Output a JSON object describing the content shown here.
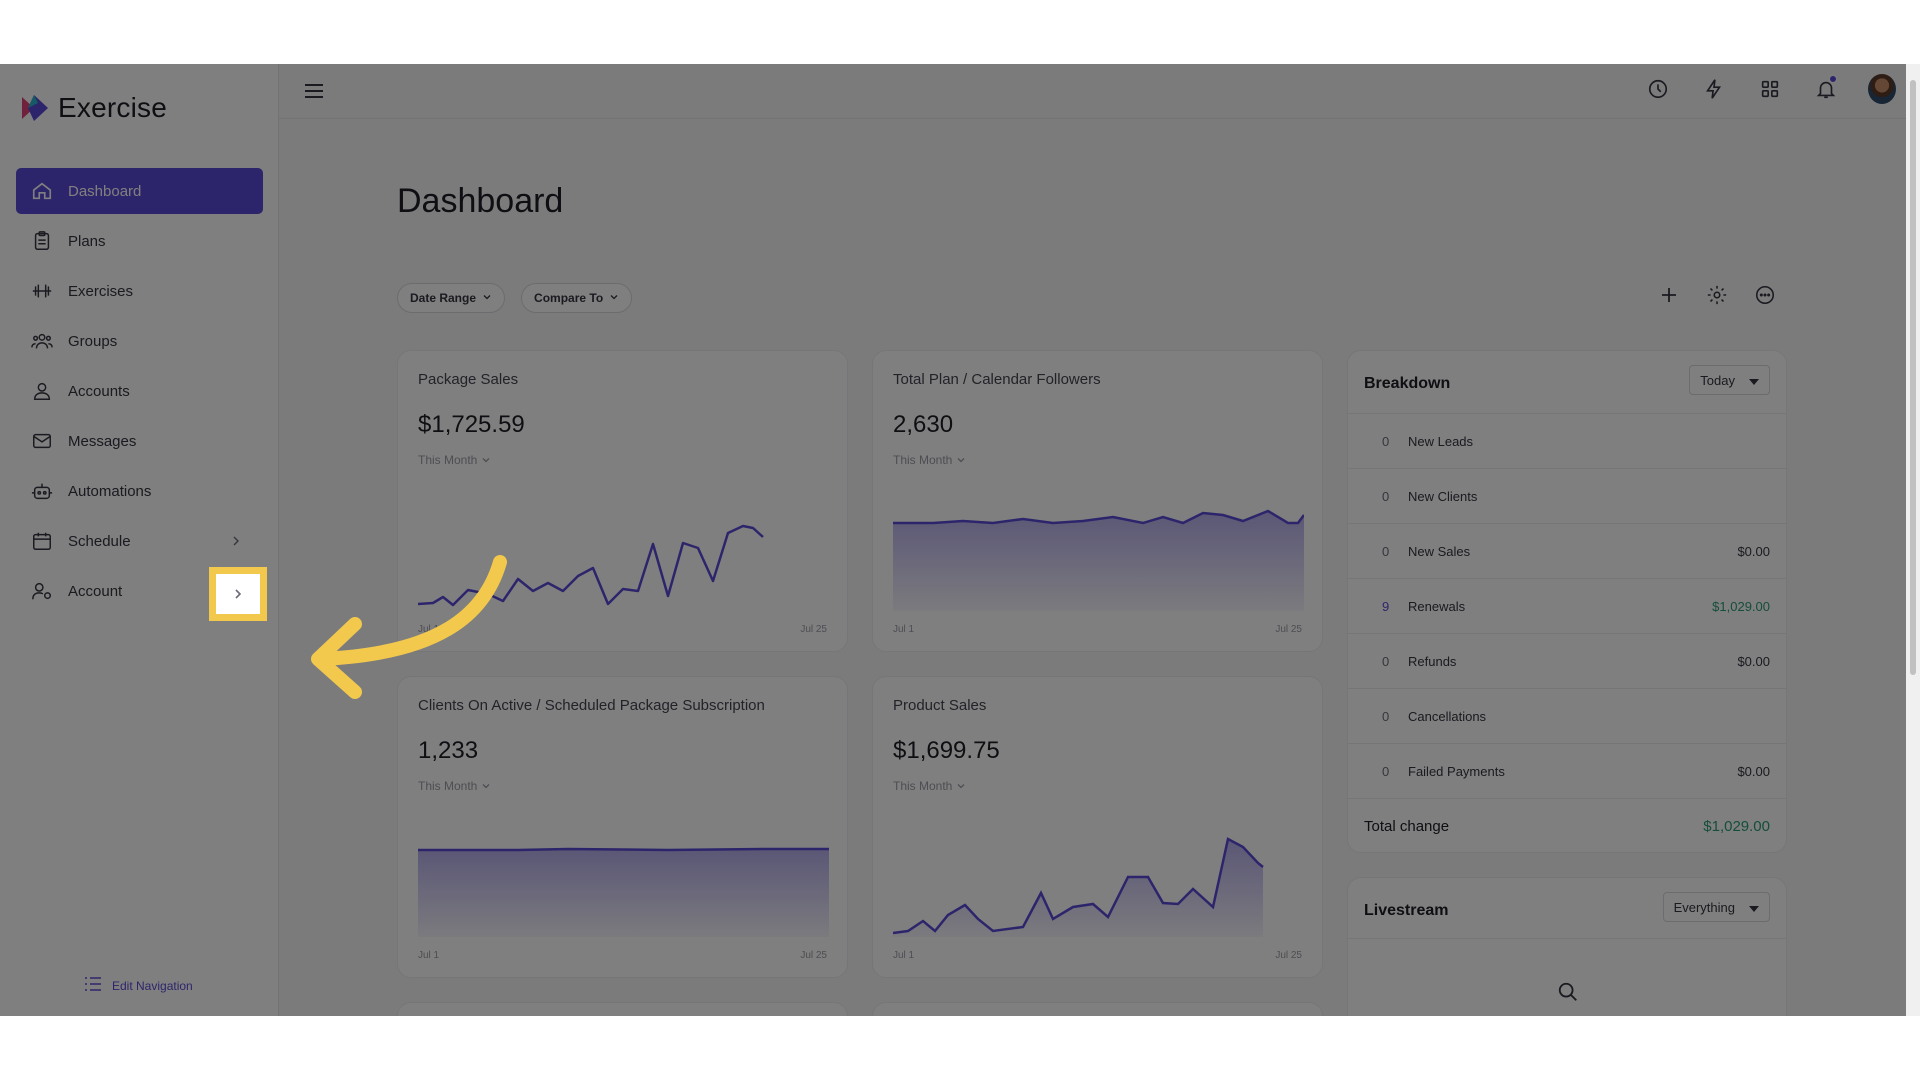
{
  "app": {
    "name": "Exercise"
  },
  "sidebar": {
    "items": [
      {
        "label": "Dashboard",
        "icon": "home-icon",
        "active": true
      },
      {
        "label": "Plans",
        "icon": "clipboard-icon"
      },
      {
        "label": "Exercises",
        "icon": "dumbbell-icon"
      },
      {
        "label": "Groups",
        "icon": "users-icon"
      },
      {
        "label": "Accounts",
        "icon": "user-icon"
      },
      {
        "label": "Messages",
        "icon": "mail-icon"
      },
      {
        "label": "Automations",
        "icon": "robot-icon"
      },
      {
        "label": "Schedule",
        "icon": "calendar-icon",
        "has_chevron": true
      },
      {
        "label": "Account",
        "icon": "user-gear-icon",
        "has_chevron": true,
        "highlighted": true
      }
    ],
    "edit_navigation": "Edit Navigation"
  },
  "topbar": {
    "icons": [
      "history-icon",
      "bolt-icon",
      "grid-icon",
      "bell-icon",
      "avatar"
    ],
    "notification_dot": true
  },
  "page": {
    "title": "Dashboard",
    "filters": [
      {
        "label": "Date Range"
      },
      {
        "label": "Compare To"
      }
    ],
    "actions": [
      "plus-icon",
      "gear-icon",
      "more-icon"
    ]
  },
  "cards": [
    {
      "title": "Package Sales",
      "value": "$1,725.59",
      "period": "This Month",
      "x_start": "Jul 1",
      "x_end": "Jul 25"
    },
    {
      "title": "Total Plan / Calendar Followers",
      "value": "2,630",
      "period": "This Month",
      "x_start": "Jul 1",
      "x_end": "Jul 25"
    },
    {
      "title": "Clients On Active / Scheduled Package Subscription",
      "value": "1,233",
      "period": "This Month",
      "x_start": "Jul 1",
      "x_end": "Jul 25"
    },
    {
      "title": "Product Sales",
      "value": "$1,699.75",
      "period": "This Month",
      "x_start": "Jul 1",
      "x_end": "Jul 25"
    }
  ],
  "breakdown": {
    "title": "Breakdown",
    "period": "Today",
    "rows": [
      {
        "count": "0",
        "label": "New Leads",
        "amount": ""
      },
      {
        "count": "0",
        "label": "New Clients",
        "amount": ""
      },
      {
        "count": "0",
        "label": "New Sales",
        "amount": "$0.00"
      },
      {
        "count": "9",
        "label": "Renewals",
        "amount": "$1,029.00"
      },
      {
        "count": "0",
        "label": "Refunds",
        "amount": "$0.00"
      },
      {
        "count": "0",
        "label": "Cancellations",
        "amount": ""
      },
      {
        "count": "0",
        "label": "Failed Payments",
        "amount": "$0.00"
      }
    ],
    "total_label": "Total change",
    "total_amount": "$1,029.00"
  },
  "livestream": {
    "title": "Livestream",
    "filter": "Everything"
  },
  "colors": {
    "accent": "#5b4bd6",
    "highlight": "#f2c94c",
    "positive": "#2a9d73"
  }
}
